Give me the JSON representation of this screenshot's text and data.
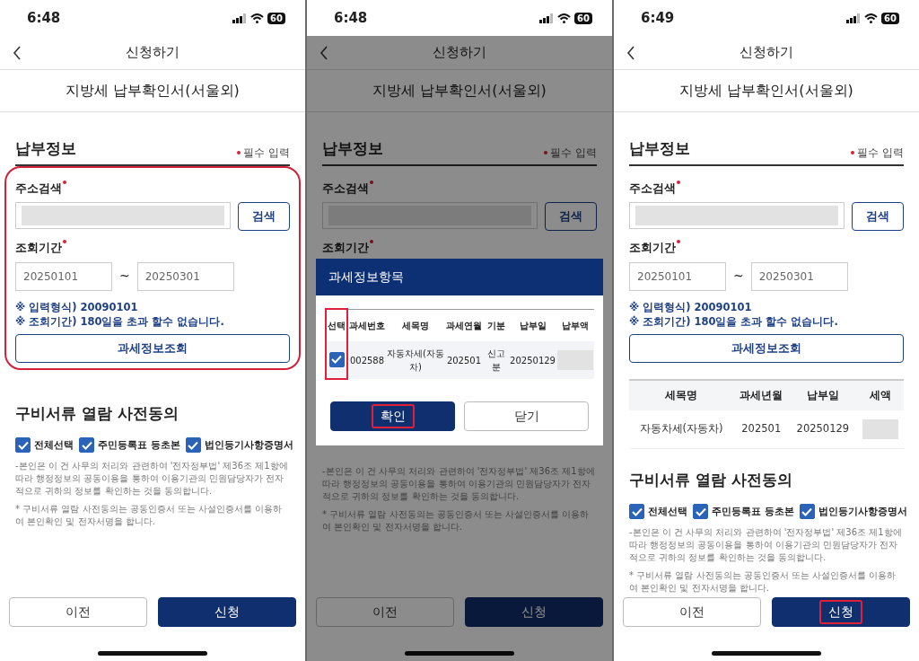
{
  "screens": [
    {
      "status_time": "6:48",
      "battery": "60",
      "header_title": "신청하기",
      "doc_title": "지방세 납부확인서(서울외)",
      "section_title": "납부정보",
      "required_note": "필수 입력",
      "form_highlighted": true,
      "address_label": "주소검색",
      "search_button": "검색",
      "period_label": "조회기간",
      "period_from": "20250101",
      "period_sep": "~",
      "period_to": "20250301",
      "notes": [
        "※ 입력형식) 20090101",
        "※ 조회기간) 180일을 초과 할수 없습니다."
      ],
      "lookup_button": "과세정보조회",
      "consent_title": "구비서류 열람 사전동의",
      "consents": [
        {
          "label": "전체선택",
          "checked": true
        },
        {
          "label": "주민등록표 등초본",
          "checked": true
        },
        {
          "label": "법인등기사항증명서",
          "checked": true
        }
      ],
      "consent_text": [
        "-본인은 이 건 사무의 처리와 관련하여 '전자정부법' 제36조 제1항에 따라 행정정보의 공동이용을 통하여 이용기관의 민원담당자가 전자적으로 귀하의 정보를 확인하는 것을 동의합니다.",
        "* 구비서류 열람 사전동의는 공동인증서 또는 사설인증서를 이용하여 본인확인 및 전자서명을 합니다."
      ],
      "buttons": [
        {
          "label": "이전",
          "kind": "secondary",
          "highlighted": false
        },
        {
          "label": "신청",
          "kind": "primary",
          "highlighted": false
        }
      ]
    },
    {
      "status_time": "6:48",
      "battery": "60",
      "header_title": "신청하기",
      "doc_title": "지방세 납부확인서(서울외)",
      "section_title": "납부정보",
      "required_note": "필수 입력",
      "form_highlighted": false,
      "address_label": "주소검색",
      "search_button": "검색",
      "period_label": "조회기간",
      "consent_text": [
        "-본인은 이 건 사무의 처리와 관련하여 '전자정부법' 제36조 제1항에 따라 행정정보의 공동이용을 통하여 이용기관의 민원담당자가 전자적으로 귀하의 정보를 확인하는 것을 동의합니다.",
        "* 구비서류 열람 사전동의는 공동인증서 또는 사설인증서를 이용하여 본인확인 및 전자서명을 합니다."
      ],
      "buttons": [
        {
          "label": "이전",
          "kind": "secondary",
          "highlighted": false
        },
        {
          "label": "신청",
          "kind": "primary",
          "highlighted": false
        }
      ],
      "modal": {
        "title": "과세정보항목",
        "select_highlighted": true,
        "columns": [
          "선택",
          "과세번호",
          "세목명",
          "과세연월",
          "기분",
          "납부일",
          "납부액"
        ],
        "rows": [
          {
            "cells": [
              {
                "checked": true
              },
              "002588",
              "자동차세(자동차)",
              "202501",
              "신고분",
              "20250129"
            ]
          }
        ],
        "buttons": [
          {
            "label": "확인",
            "kind": "primary",
            "highlighted": true
          },
          {
            "label": "닫기",
            "kind": "secondary",
            "highlighted": false
          }
        ]
      }
    },
    {
      "status_time": "6:49",
      "battery": "60",
      "header_title": "신청하기",
      "doc_title": "지방세 납부확인서(서울외)",
      "section_title": "납부정보",
      "required_note": "필수 입력",
      "form_highlighted": false,
      "address_label": "주소검색",
      "search_button": "검색",
      "period_label": "조회기간",
      "period_from": "20250101",
      "period_sep": "~",
      "period_to": "20250301",
      "notes": [
        "※ 입력형식) 20090101",
        "※ 조회기간) 180일을 초과 할수 없습니다."
      ],
      "lookup_button": "과세정보조회",
      "result_table": {
        "columns": [
          "세목명",
          "과세년월",
          "납부일",
          "세액"
        ],
        "rows": [
          [
            "자동차세(자동차)",
            "202501",
            "20250129"
          ]
        ]
      },
      "consent_title": "구비서류 열람 사전동의",
      "consents": [
        {
          "label": "전체선택",
          "checked": true
        },
        {
          "label": "주민등록표 등초본",
          "checked": true
        },
        {
          "label": "법인등기사항증명서",
          "checked": true
        }
      ],
      "consent_text": [
        "-본인은 이 건 사무의 처리와 관련하여 '전자정부법' 제36조 제1항에 따라 행정정보의 공동이용을 통하여 이용기관의 민원담당자가 전자적으로 귀하의 정보를 확인하는 것을 동의합니다.",
        "* 구비서류 열람 사전동의는 공동인증서 또는 사설인증서를 이용하여 본인확인 및 전자서명을 합니다."
      ],
      "buttons": [
        {
          "label": "이전",
          "kind": "secondary",
          "highlighted": false
        },
        {
          "label": "신청",
          "kind": "primary",
          "highlighted": true
        }
      ]
    }
  ]
}
